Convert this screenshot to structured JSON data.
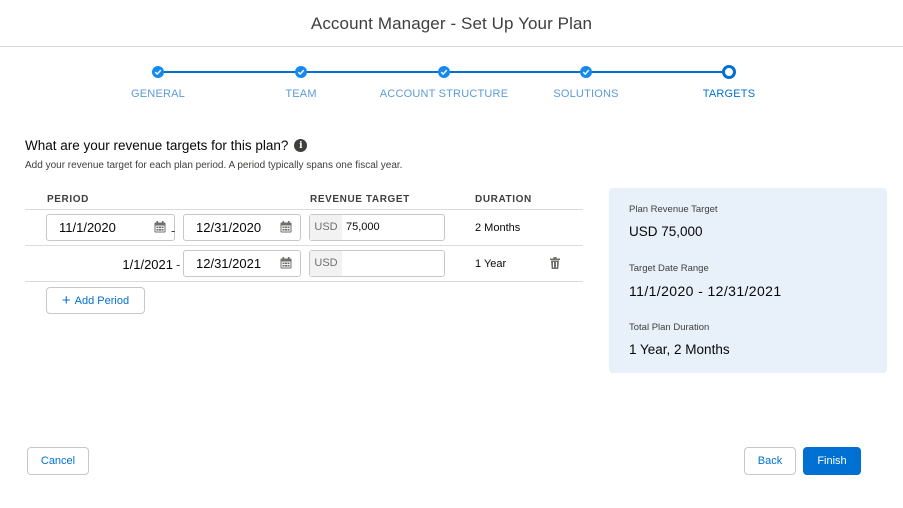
{
  "header": {
    "title": "Account Manager - Set Up Your Plan"
  },
  "stepper": {
    "steps": [
      {
        "label": "GENERAL",
        "status": "complete"
      },
      {
        "label": "TEAM",
        "status": "complete"
      },
      {
        "label": "ACCOUNT STRUCTURE",
        "status": "complete"
      },
      {
        "label": "SOLUTIONS",
        "status": "complete"
      },
      {
        "label": "TARGETS",
        "status": "current"
      }
    ]
  },
  "question": {
    "title": "What are your revenue targets for this plan?",
    "info_icon": "info-icon",
    "subtext": "Add your revenue target for each plan period. A period typically spans one fiscal year."
  },
  "table": {
    "headers": {
      "period": "PERIOD",
      "revenue_target": "REVENUE TARGET",
      "duration": "DURATION"
    },
    "rows": [
      {
        "start": "11/1/2020",
        "separator": "-",
        "end": "12/31/2020",
        "currency": "USD",
        "revenue": "75,000",
        "duration": "2 Months"
      },
      {
        "start": "1/1/2021",
        "separator": "-",
        "end": "12/31/2021",
        "currency": "USD",
        "revenue": "",
        "duration": "1 Year"
      }
    ]
  },
  "add_period": {
    "plus": "+",
    "label": "Add Period"
  },
  "summary": {
    "revenue_label": "Plan Revenue Target",
    "revenue_value": "USD 75,000",
    "range_label": "Target Date Range",
    "range_value": "11/1/2020 - 12/31/2021",
    "duration_label": "Total Plan Duration",
    "duration_value": "1 Year, 2 Months"
  },
  "footer": {
    "cancel": "Cancel",
    "back": "Back",
    "finish": "Finish"
  },
  "colors": {
    "brand": "#0070d2",
    "summary_bg": "#e8f1f9",
    "border": "#dddbda"
  }
}
